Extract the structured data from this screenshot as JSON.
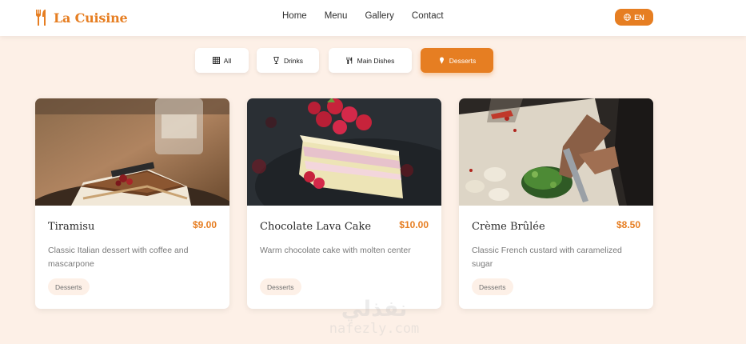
{
  "brand": {
    "name": "La Cuisine",
    "icon": "fork-knife-icon",
    "color": "#e67e22"
  },
  "nav": {
    "items": [
      "Home",
      "Menu",
      "Gallery",
      "Contact"
    ]
  },
  "language": {
    "label": "EN",
    "icon": "globe-icon"
  },
  "filters": [
    {
      "label": "All",
      "icon": "grid-icon",
      "active": false
    },
    {
      "label": "Drinks",
      "icon": "glass-icon",
      "active": false
    },
    {
      "label": "Main Dishes",
      "icon": "utensils-icon",
      "active": false
    },
    {
      "label": "Desserts",
      "icon": "ice-cream-icon",
      "active": true
    }
  ],
  "menu_items": [
    {
      "title": "Tiramisu",
      "price": "$9.00",
      "description": "Classic Italian dessert with coffee and mascarpone",
      "tag": "Desserts"
    },
    {
      "title": "Chocolate Lava Cake",
      "price": "$10.00",
      "description": "Warm chocolate cake with molten center",
      "tag": "Desserts"
    },
    {
      "title": "Crème Brûlée",
      "price": "$8.50",
      "description": "Classic French custard with caramelized sugar",
      "tag": "Desserts"
    }
  ],
  "watermark": {
    "arabic": "نفذلي",
    "latin": "nafezly.com"
  },
  "colors": {
    "accent": "#e67e22",
    "background": "#fdf0e7",
    "card": "#ffffff"
  }
}
